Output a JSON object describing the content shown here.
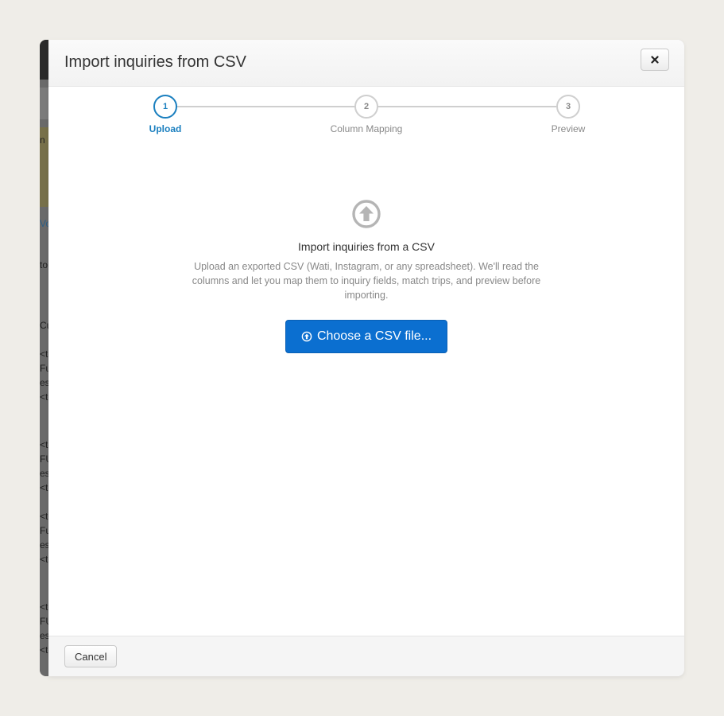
{
  "modal": {
    "title": "Import inquiries from CSV",
    "close_icon": "close-x-icon"
  },
  "stepper": {
    "steps": [
      {
        "number": "1",
        "label": "Upload",
        "active": true
      },
      {
        "number": "2",
        "label": "Column Mapping",
        "active": false
      },
      {
        "number": "3",
        "label": "Preview",
        "active": false
      }
    ]
  },
  "upload": {
    "icon": "arrow-up-circle-icon",
    "title": "Import inquiries from a CSV",
    "description": "Upload an exported CSV (Wati, Instagram, or any spreadsheet). We'll read the columns and let you map them to inquiry fields, match trips, and preview before importing.",
    "button_label": "Choose a CSV file..."
  },
  "footer": {
    "cancel_label": "Cancel"
  },
  "background_fragments": [
    "n",
    "Vo",
    "to",
    "Cu",
    "<te",
    "Ful",
    "es",
    "<te",
    "<te",
    "FU",
    "es",
    "<te",
    "<te",
    "Ful",
    "es",
    "<te",
    "<te",
    "FU",
    "es",
    "<te"
  ],
  "colors": {
    "accent": "#1a7fbf",
    "primary_button": "#0b6fd0"
  }
}
